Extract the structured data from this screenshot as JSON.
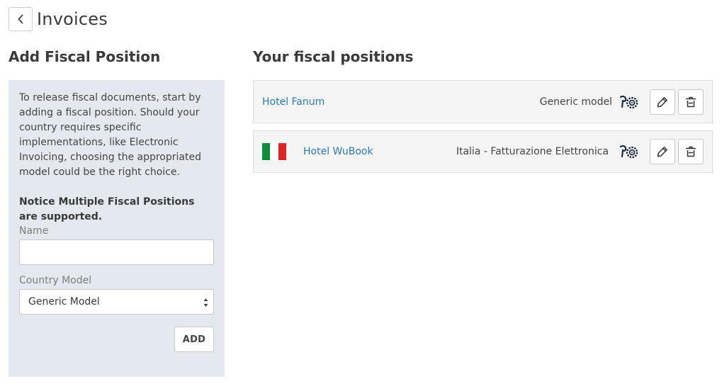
{
  "header": {
    "title": "Invoices"
  },
  "add_panel": {
    "title": "Add Fiscal Position",
    "intro": "To release fiscal documents, start by adding a fiscal position. Should your country requires specific implementations, like Electronic Invoicing, choosing the appropriated model could be the right choice.",
    "notice": "Notice Multiple Fiscal Positions are supported.",
    "name_label": "Name",
    "name_value": "",
    "country_label": "Country Model",
    "country_value": "Generic Model",
    "add_label": "ADD"
  },
  "list": {
    "title": "Your fiscal positions",
    "items": [
      {
        "name": "Hotel Fanum",
        "model": "Generic model",
        "flag": false
      },
      {
        "name": "Hotel WuBook",
        "model": "Italia - Fatturazione Elettronica",
        "flag": true,
        "flag_colors": [
          "#118c3b",
          "#ffffff",
          "#e02424"
        ]
      }
    ]
  },
  "colors": {
    "link": "#2a7ab8",
    "panel_bg": "#e4e9f0",
    "row_bg": "#f5f5f5",
    "icon_dark": "#1d2b3a"
  },
  "icons": [
    "chevron-left-icon",
    "model-logo-icon",
    "pencil-icon",
    "trash-icon",
    "select-arrows-icon"
  ]
}
